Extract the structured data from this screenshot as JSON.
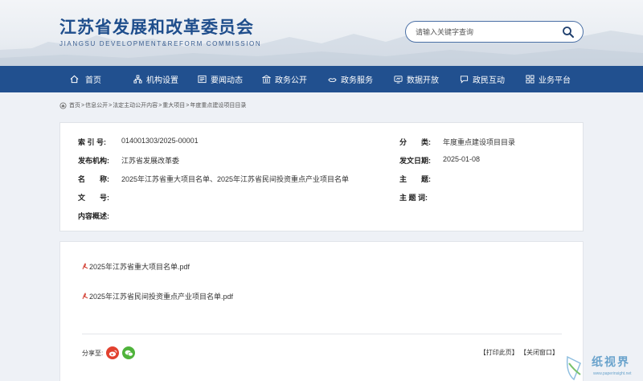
{
  "header": {
    "title_cn": "江苏省发展和改革委员会",
    "title_en": "JIANGSU DEVELOPMENT&REFORM COMMISSION",
    "search_placeholder": "请输入关键字查询"
  },
  "nav": [
    {
      "label": "首页",
      "icon": "home-icon"
    },
    {
      "label": "机构设置",
      "icon": "org-icon"
    },
    {
      "label": "要闻动态",
      "icon": "news-icon"
    },
    {
      "label": "政务公开",
      "icon": "building-icon"
    },
    {
      "label": "政务服务",
      "icon": "service-icon"
    },
    {
      "label": "数据开放",
      "icon": "data-icon"
    },
    {
      "label": "政民互动",
      "icon": "chat-icon"
    },
    {
      "label": "业务平台",
      "icon": "grid-icon"
    }
  ],
  "breadcrumb": [
    "首页",
    "信息公开",
    "法定主动公开内容",
    "重大项目",
    "年度重点建设项目目录"
  ],
  "meta": {
    "index_label": "索 引 号:",
    "index_value": "014001303/2025-00001",
    "category_label": "分　　类:",
    "category_value": "年度重点建设项目目录",
    "issuer_label": "发布机构:",
    "issuer_value": "江苏省发展改革委",
    "date_label": "发文日期:",
    "date_value": "2025-01-08",
    "name_label": "名　　称:",
    "name_value": "2025年江苏省重大项目名单、2025年江苏省民间投资重点产业项目名单",
    "subject_label": "主　　题:",
    "subject_value": "",
    "docno_label": "文　　号:",
    "docno_value": "",
    "keywords_label": "主 题 词:",
    "keywords_value": "",
    "summary_label": "内容概述:",
    "summary_value": ""
  },
  "files": [
    {
      "name": "2025年江苏省重大项目名单.pdf",
      "icon": "pdf-icon"
    },
    {
      "name": "2025年江苏省民间投资重点产业项目名单.pdf",
      "icon": "pdf-icon"
    }
  ],
  "share_label": "分享至:",
  "actions": {
    "print": "【打印此页】",
    "close": "【关闭窗口】"
  },
  "watermark": {
    "text": "纸视界",
    "sub": "www.paperinsight.net"
  }
}
